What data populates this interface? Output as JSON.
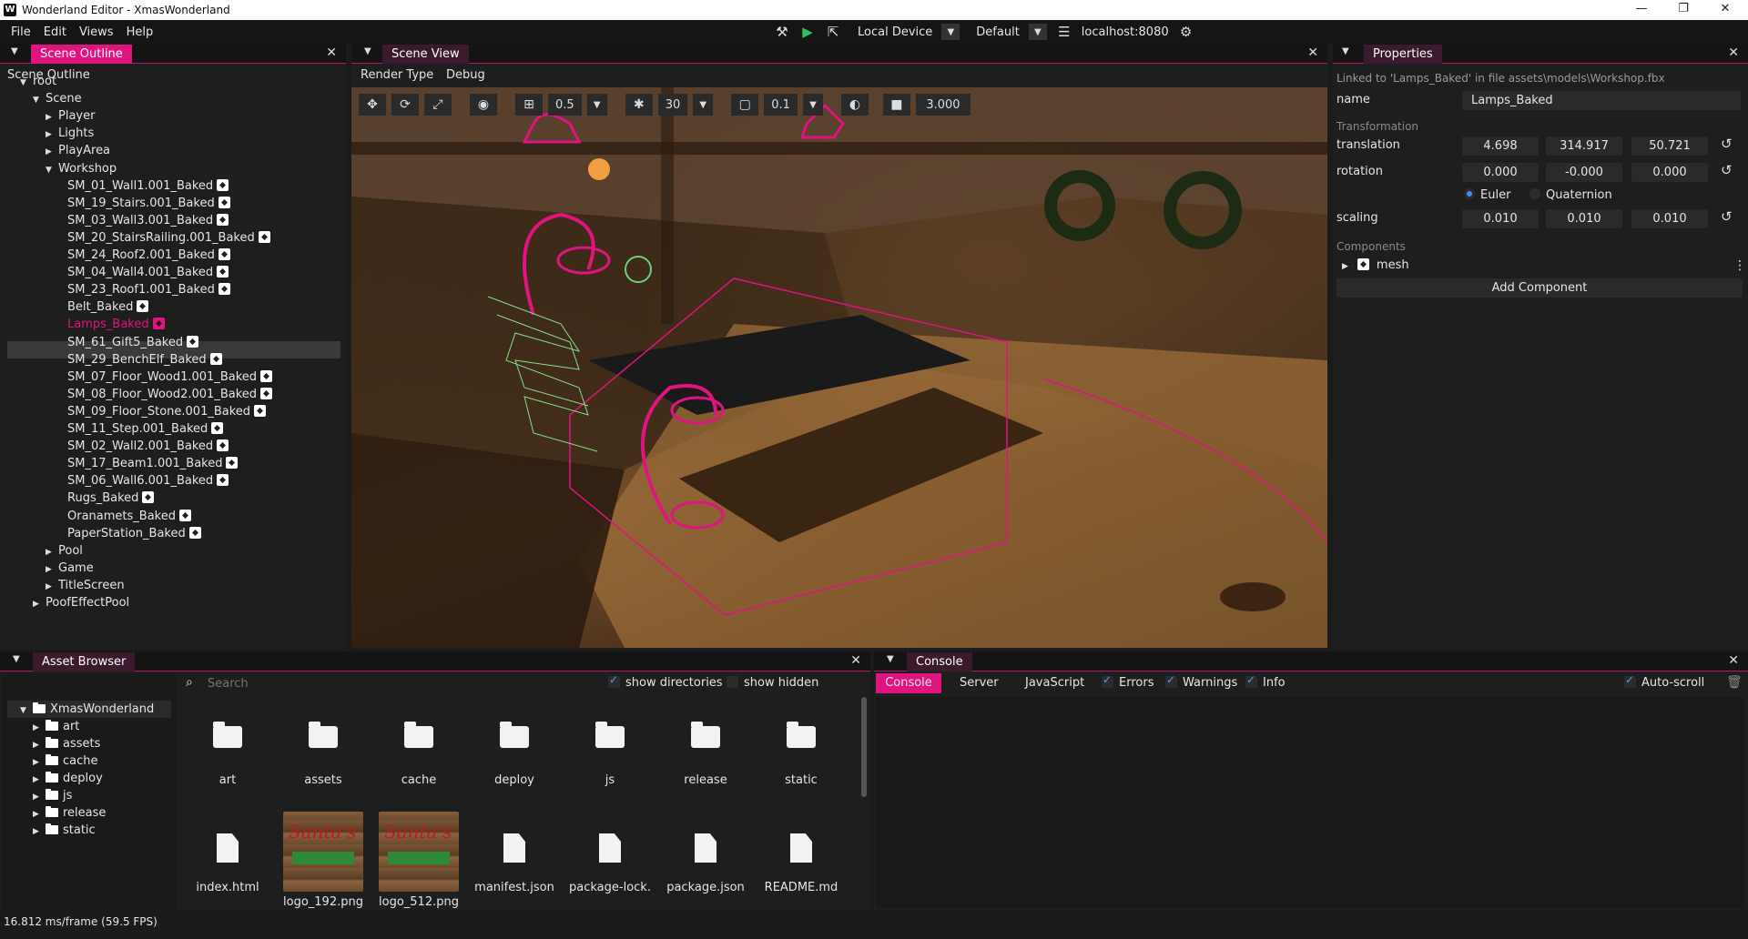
{
  "window": {
    "title": "Wonderland Editor - XmasWonderland"
  },
  "menu": [
    "File",
    "Edit",
    "Views",
    "Help"
  ],
  "toolbar": {
    "device": "Local Device",
    "profile": "Default",
    "server": "localhost:8080"
  },
  "scene_outline": {
    "tab": "Scene Outline",
    "heading": "Scene Outline",
    "tree": [
      {
        "label": "root",
        "depth": 0,
        "arrow": "▼",
        "mesh": false
      },
      {
        "label": "Scene",
        "depth": 1,
        "arrow": "▼",
        "mesh": false
      },
      {
        "label": "Player",
        "depth": 2,
        "arrow": "▶",
        "mesh": false
      },
      {
        "label": "Lights",
        "depth": 2,
        "arrow": "▶",
        "mesh": false
      },
      {
        "label": "PlayArea",
        "depth": 2,
        "arrow": "▶",
        "mesh": false
      },
      {
        "label": "Workshop",
        "depth": 2,
        "arrow": "▼",
        "mesh": false
      },
      {
        "label": "SM_01_Wall1.001_Baked",
        "depth": 3,
        "arrow": "",
        "mesh": true
      },
      {
        "label": "SM_19_Stairs.001_Baked",
        "depth": 3,
        "arrow": "",
        "mesh": true
      },
      {
        "label": "SM_03_Wall3.001_Baked",
        "depth": 3,
        "arrow": "",
        "mesh": true
      },
      {
        "label": "SM_20_StairsRailing.001_Baked",
        "depth": 3,
        "arrow": "",
        "mesh": true
      },
      {
        "label": "SM_24_Roof2.001_Baked",
        "depth": 3,
        "arrow": "",
        "mesh": true
      },
      {
        "label": "SM_04_Wall4.001_Baked",
        "depth": 3,
        "arrow": "",
        "mesh": true
      },
      {
        "label": "SM_23_Roof1.001_Baked",
        "depth": 3,
        "arrow": "",
        "mesh": true
      },
      {
        "label": "Belt_Baked",
        "depth": 3,
        "arrow": "",
        "mesh": true
      },
      {
        "label": "Lamps_Baked",
        "depth": 3,
        "arrow": "",
        "mesh": true,
        "selected": true
      },
      {
        "label": "SM_61_Gift5_Baked",
        "depth": 3,
        "arrow": "",
        "mesh": true
      },
      {
        "label": "SM_29_BenchElf_Baked",
        "depth": 3,
        "arrow": "",
        "mesh": true
      },
      {
        "label": "SM_07_Floor_Wood1.001_Baked",
        "depth": 3,
        "arrow": "",
        "mesh": true
      },
      {
        "label": "SM_08_Floor_Wood2.001_Baked",
        "depth": 3,
        "arrow": "",
        "mesh": true
      },
      {
        "label": "SM_09_Floor_Stone.001_Baked",
        "depth": 3,
        "arrow": "",
        "mesh": true
      },
      {
        "label": "SM_11_Step.001_Baked",
        "depth": 3,
        "arrow": "",
        "mesh": true
      },
      {
        "label": "SM_02_Wall2.001_Baked",
        "depth": 3,
        "arrow": "",
        "mesh": true
      },
      {
        "label": "SM_17_Beam1.001_Baked",
        "depth": 3,
        "arrow": "",
        "mesh": true
      },
      {
        "label": "SM_06_Wall6.001_Baked",
        "depth": 3,
        "arrow": "",
        "mesh": true
      },
      {
        "label": "Rugs_Baked",
        "depth": 3,
        "arrow": "",
        "mesh": true
      },
      {
        "label": "Oranamets_Baked",
        "depth": 3,
        "arrow": "",
        "mesh": true
      },
      {
        "label": "PaperStation_Baked",
        "depth": 3,
        "arrow": "",
        "mesh": true
      },
      {
        "label": "Pool",
        "depth": 2,
        "arrow": "▶",
        "mesh": false
      },
      {
        "label": "Game",
        "depth": 2,
        "arrow": "▶",
        "mesh": false
      },
      {
        "label": "TitleScreen",
        "depth": 2,
        "arrow": "▶",
        "mesh": false
      },
      {
        "label": "PoofEffectPool",
        "depth": 1,
        "arrow": "▶",
        "mesh": false
      }
    ]
  },
  "scene_view": {
    "tab": "Scene View",
    "menu": [
      "Render Type",
      "Debug"
    ],
    "grid_value": "0.5",
    "angle_value": "30",
    "scale_value": "0.1",
    "camera_value": "3.000"
  },
  "properties": {
    "tab": "Properties",
    "linked": "Linked to 'Lamps_Baked' in file assets\\models\\Workshop.fbx",
    "name_label": "name",
    "name_value": "Lamps_Baked",
    "transformation_label": "Transformation",
    "translation_label": "translation",
    "translation": [
      "4.698",
      "314.917",
      "50.721"
    ],
    "rotation_label": "rotation",
    "rotation": [
      "0.000",
      "-0.000",
      "0.000"
    ],
    "euler_label": "Euler",
    "quaternion_label": "Quaternion",
    "scaling_label": "scaling",
    "scaling": [
      "0.010",
      "0.010",
      "0.010"
    ],
    "components_label": "Components",
    "component": "mesh",
    "add_component": "Add Component"
  },
  "asset_browser": {
    "tab": "Asset Browser",
    "root": "XmasWonderland",
    "folders": [
      "art",
      "assets",
      "cache",
      "deploy",
      "js",
      "release",
      "static"
    ],
    "search_placeholder": "Search",
    "show_directories": "show directories",
    "show_hidden": "show hidden",
    "items_row1": [
      "art",
      "assets",
      "cache",
      "deploy",
      "js",
      "release",
      "static"
    ],
    "items_row2": [
      "index.html",
      "logo_192.png",
      "logo_512.png",
      "manifest.json",
      "package-lock.",
      "package.json",
      "README.md"
    ],
    "thumb_text": "Santa's"
  },
  "console": {
    "tab": "Console",
    "tabs": [
      "Console",
      "Server",
      "JavaScript"
    ],
    "filters": [
      "Errors",
      "Warnings",
      "Info"
    ],
    "auto_scroll": "Auto-scroll"
  },
  "status": {
    "frame": "16.812 ms/frame (59.5 FPS)"
  },
  "colors": {
    "accent": "#e0147f",
    "background": "#1e1e1e",
    "header": "#141414"
  }
}
